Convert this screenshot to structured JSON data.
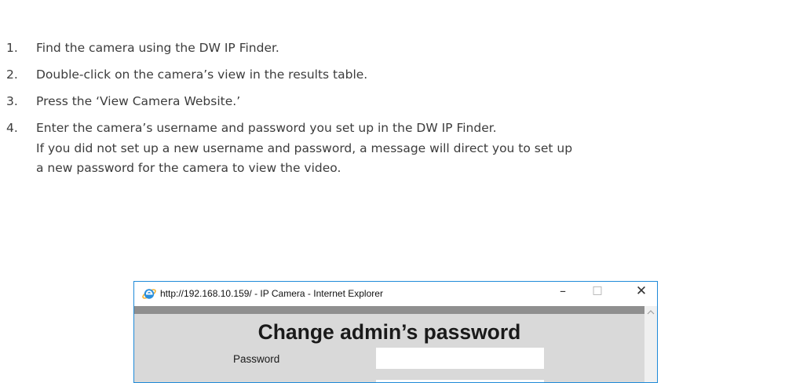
{
  "steps": [
    {
      "num": "1.",
      "lines": [
        "Find the camera using the DW IP Finder."
      ]
    },
    {
      "num": "2.",
      "lines": [
        "Double-click on the camera’s view in the results table."
      ]
    },
    {
      "num": "3.",
      "lines": [
        "Press the ‘View Camera Website.’"
      ]
    },
    {
      "num": "4.",
      "lines": [
        "Enter the camera’s username and password you set up in the DW IP Finder.",
        "If you did not set up a new username and password, a message will direct you to set up",
        "a new password for the camera to view the video."
      ]
    }
  ],
  "browser": {
    "icon": "internet-explorer-icon",
    "title": "http://192.168.10.159/ - IP Camera - Internet Explorer",
    "minimize": "–",
    "maximize": "□",
    "close": "✕",
    "accent": "#1f8ad8"
  },
  "form": {
    "heading": "Change admin’s password",
    "password_label": "Password",
    "password_value": ""
  }
}
